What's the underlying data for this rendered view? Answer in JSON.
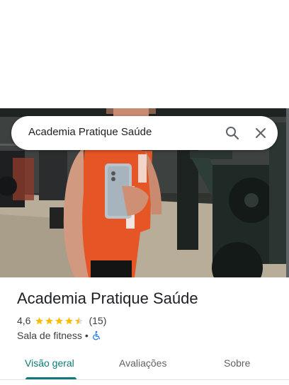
{
  "search": {
    "query": "Academia Pratique Saúde"
  },
  "place": {
    "title": "Academia Pratique Saúde",
    "rating": "4,6",
    "rating_stars": 4.5,
    "review_count": "(15)",
    "category": "Sala de fitness",
    "separator": "•",
    "accessibility_icon": "wheelchair-icon"
  },
  "tabs": [
    {
      "label": "Visão geral",
      "active": true
    },
    {
      "label": "Avaliações",
      "active": false
    },
    {
      "label": "Sobre",
      "active": false
    }
  ],
  "colors": {
    "accent": "#0b7a78",
    "star": "#fbbc04",
    "accessibility": "#1a73e8"
  }
}
